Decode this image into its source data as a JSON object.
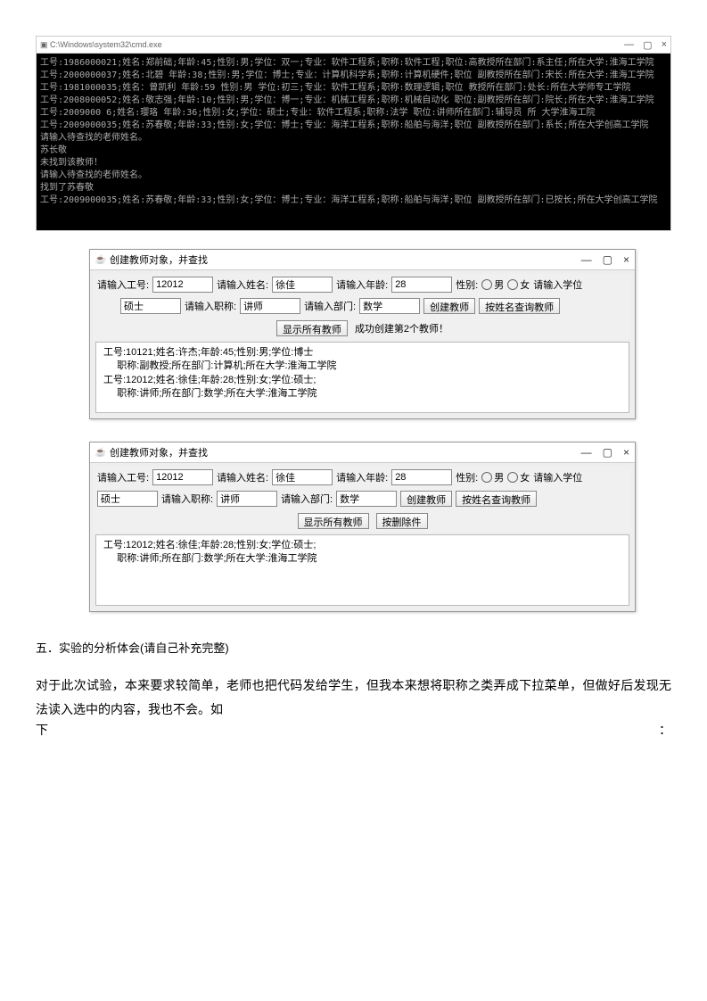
{
  "cmd": {
    "title": "C:\\Windows\\system32\\cmd.exe",
    "ctrl_min": "—",
    "ctrl_max": "▢",
    "ctrl_close": "×",
    "body": "工号:1986000021;姓名:郑前础;年龄:45;性别:男;学位：双一;专业：软件工程系;职称:软件工程;职位:高教授所在部门:系主任;所在大学:淮海工学院\n工号:2000000037;姓名:北碧 年龄:38;性别:男;学位：博士;专业：计算机科学系;职称:计算机硬件;职位 副教授所在部门:宋长:所在大学:淮海工学院\n工号:1981000035;姓名：曾凯利 年龄:59 性别:男 学位:初三;专业：软件工程系;职称:数理逻辑;职位 教授所在部门:处长:所在大学师专工学院\n工号:2008000052;姓名:敬志强;年龄:10;性别:男;学位：博一;专业：机械工程系;职称:机械自动化 职位:副教授所在部门:院长;所在大学:淮海工学院\n工号:2009000 6;姓名:璎珞 年龄:36;性别:女;学位：硕士;专业：软件工程系;职称:法学 职位:讲师所在部门:辅导员 所 大学淮海工院\n工号:2009000035;姓名:苏春敬;年龄:33;性别:女;学位：博士;专业：海洋工程系;职称:船舶与海洋;职位 副教授所在部门:系长;所在大学创高工学院\n请输入待查找的老师姓名。\n苏长敬\n未找到该教师！\n请输入待查找的老师姓名。\n找到了苏春敬\n工号:2009000035;姓名:苏春敬;年龄:33;性别:女;学位：博士;专业：海洋工程系;职称:船舶与海洋;职位 副教授所在部门:已按长;所在大学创高工学院"
  },
  "win1": {
    "title": "创建教师对象，并查找",
    "ctrl_min": "—",
    "ctrl_max": "▢",
    "ctrl_close": "×",
    "labels": {
      "id": "请输入工号:",
      "name": "请输入姓名:",
      "age": "请输入年龄:",
      "gender": "性别:",
      "male": "男",
      "female": "女",
      "degree": "请输入学位",
      "zhicheng": "请输入职称:",
      "dept": "请输入部门:"
    },
    "values": {
      "id": "12012",
      "name": "徐佳",
      "age": "28",
      "degree": "硕士",
      "zhicheng": "讲师",
      "dept": "数学"
    },
    "btn_create": "创建教师",
    "btn_search": "按姓名查询教师",
    "btn_showall": "显示所有教师",
    "status": "成功创建第2个教师！",
    "result": "工号:10121;姓名:许杰;年龄:45;性别:男;学位:博士\n     职称:副教授;所在部门:计算机;所在大学:淮海工学院\n工号:12012;姓名:徐佳;年龄:28;性别:女;学位:硕士;\n     职称:讲师;所在部门:数学;所在大学:淮海工学院"
  },
  "win2": {
    "title": "创建教师对象，并查找",
    "ctrl_min": "—",
    "ctrl_max": "▢",
    "ctrl_close": "×",
    "labels": {
      "id": "请输入工号:",
      "name": "请输入姓名:",
      "age": "请输入年龄:",
      "gender": "性别:",
      "male": "男",
      "female": "女",
      "degree": "请输入学位",
      "zhicheng": "请输入职称:",
      "dept": "请输入部门:"
    },
    "values": {
      "id": "12012",
      "name": "徐佳",
      "age": "28",
      "degree": "硕士",
      "zhicheng": "讲师",
      "dept": "数学"
    },
    "btn_create": "创建教师",
    "btn_search": "按姓名查询教师",
    "btn_showall": "显示所有教师",
    "btn_del": "按删除件",
    "result": "工号:12012;姓名:徐佳;年龄:28;性别:女;学位:硕士;\n     职称:讲师;所在部门:数学;所在大学:淮海工学院"
  },
  "section5_title": "五．实验的分析体会(请自己补充完整)",
  "para": "对于此次试验，本来要求较简单，老师也把代码发给学生，但我本来想将职称之类弄成下拉菜单，但做好后发现无法读入选中的内容，我也不会。如",
  "para_last_left": "下",
  "para_last_right": "："
}
